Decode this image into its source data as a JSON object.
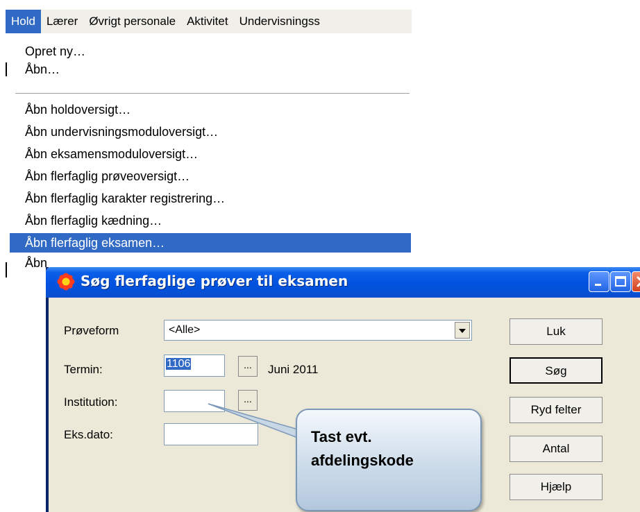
{
  "menubar": {
    "items": [
      "Hold",
      "Lærer",
      "Øvrigt personale",
      "Aktivitet",
      "Undervisningss"
    ]
  },
  "dropdown": {
    "group1": [
      "Opret ny…",
      "Åbn…"
    ],
    "group2": [
      "Åbn holdoversigt…",
      "Åbn undervisningsmoduloversigt…",
      "Åbn eksamensmoduloversigt…",
      "Åbn flerfaglig prøveoversigt…",
      "Åbn flerfaglig karakter registrering…",
      "Åbn flerfaglig kædning…",
      "Åbn flerfaglig eksamen…",
      "Åbn"
    ]
  },
  "dialog": {
    "title": "Søg flerfaglige prøver til eksamen",
    "labels": {
      "proveform": "Prøveform",
      "termin": "Termin:",
      "institution": "Institution:",
      "eksdato": "Eks.dato:"
    },
    "proveform_value": "<Alle>",
    "termin_value": "1106",
    "termin_text": "Juni 2011",
    "institution_value": "",
    "eksdato_value": "",
    "browse_label": "...",
    "buttons": {
      "luk": "Luk",
      "sog": "Søg",
      "ryd": "Ryd felter",
      "antal": "Antal",
      "hjaelp": "Hjælp"
    }
  },
  "callout": {
    "line1": "Tast evt.",
    "line2": "afdelingskode"
  },
  "colors": {
    "selection": "#316ac5",
    "titlebar": "#0052de",
    "dialog_bg": "#ece9d8"
  }
}
